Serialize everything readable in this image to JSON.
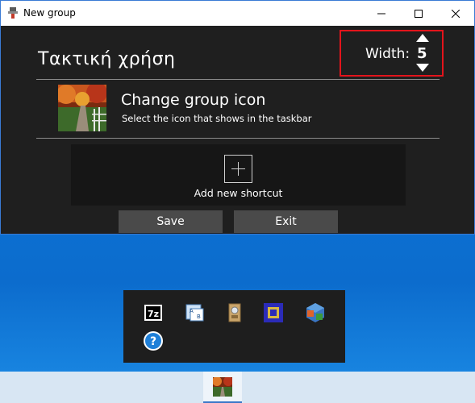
{
  "window": {
    "title": "New group",
    "group_name": "Τακτική χρήση",
    "width_label": "Width:",
    "width_value": "5",
    "change_icon_title": "Change group icon",
    "change_icon_subtitle": "Select the icon that shows in the taskbar",
    "add_shortcut_label": "Add new shortcut",
    "save_label": "Save",
    "exit_label": "Exit"
  },
  "popup_icons": [
    "7zip-icon",
    "dictionary-icon",
    "archive-icon",
    "cpu-icon",
    "virtualbox-icon",
    "help-icon"
  ],
  "colors": {
    "window_bg": "#1f1f1f",
    "highlight_border": "#e3141b",
    "button_bg": "#4a4a4a",
    "desktop": "#0a74d6"
  }
}
